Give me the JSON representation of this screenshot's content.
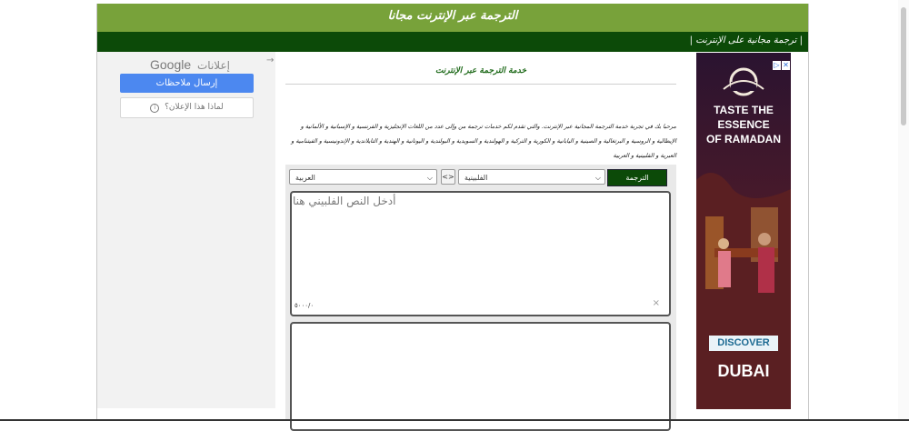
{
  "header": {
    "site_title": "الترجمة عبر الإنترنت مجانا",
    "nav_link": "| ترجمة مجانية على الإنترنت |"
  },
  "sidebar_ad": {
    "close_icon": "→",
    "ads_label": "إعلانات",
    "brand": "Google",
    "feedback_button": "إرسال ملاحظات",
    "why_ad_button": "لماذا هذا الإعلان؟"
  },
  "main": {
    "service_title": "خدمة الترجمة عبر الإنترنت",
    "intro_text": "مرحبا بك في تجربة خدمة الترجمة المجانية عبر الإنترنت. والتي تقدم لكم خدمات ترجمة من وإلى عدد من اللغات الإنجليزية و الفرنسية و الإسبانية و الألمانية و الإيطالية و الروسية و البرتغالية و الصينية و اليابانية و الكورية و التركية و الهولندية و السويدية و البولندية و اليونانية و الهندية و التايلاندية و الإندونيسية و الفيتنامية و العبرية و الفلبينية و العربية",
    "translator": {
      "translate_button": "الترجمة",
      "source_language": "الفلبينية",
      "swap_button": "<>",
      "target_language": "العربية",
      "input_placeholder": "أدخل النص الفلبيني هنا",
      "char_count": "٥٠٠٠/٠",
      "clear_icon": "×"
    }
  },
  "right_ad": {
    "title_line1": "TASTE THE",
    "title_line2": "ESSENCE",
    "title_line3": "OF RAMADAN",
    "cta": "DISCOVER",
    "logo": "DUBAI",
    "badge_info": "▷",
    "badge_close": "✕"
  },
  "colors": {
    "header_green": "#78a23a",
    "nav_dark_green": "#0c4a08",
    "feedback_blue": "#4c88f0"
  }
}
